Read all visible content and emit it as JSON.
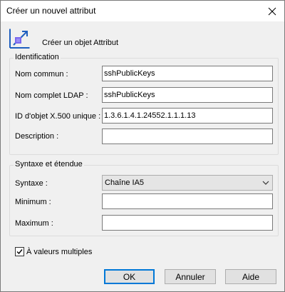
{
  "window": {
    "title": "Créer un nouvel attribut"
  },
  "header": {
    "text": "Créer un objet Attribut",
    "icon": "attribute-icon"
  },
  "identification": {
    "group_title": "Identification",
    "common_name_label": "Nom commun :",
    "common_name_value": "sshPublicKeys",
    "ldap_name_label": "Nom complet LDAP :",
    "ldap_name_value": "sshPublicKeys",
    "oid_label": "ID d'objet X.500 unique :",
    "oid_value": "1.3.6.1.4.1.24552.1.1.1.13",
    "description_label": "Description :",
    "description_value": ""
  },
  "syntax": {
    "group_title": "Syntaxe et étendue",
    "syntax_label": "Syntaxe :",
    "syntax_value": "Chaîne IA5",
    "minimum_label": "Minimum :",
    "minimum_value": "",
    "maximum_label": "Maximum :",
    "maximum_value": ""
  },
  "multivalued": {
    "label": "À valeurs multiples",
    "checked": true
  },
  "buttons": {
    "ok": "OK",
    "cancel": "Annuler",
    "help": "Aide"
  },
  "colors": {
    "accent": "#0078d7",
    "icon_blue": "#1f5fbf",
    "icon_purple": "#7b68ee"
  }
}
